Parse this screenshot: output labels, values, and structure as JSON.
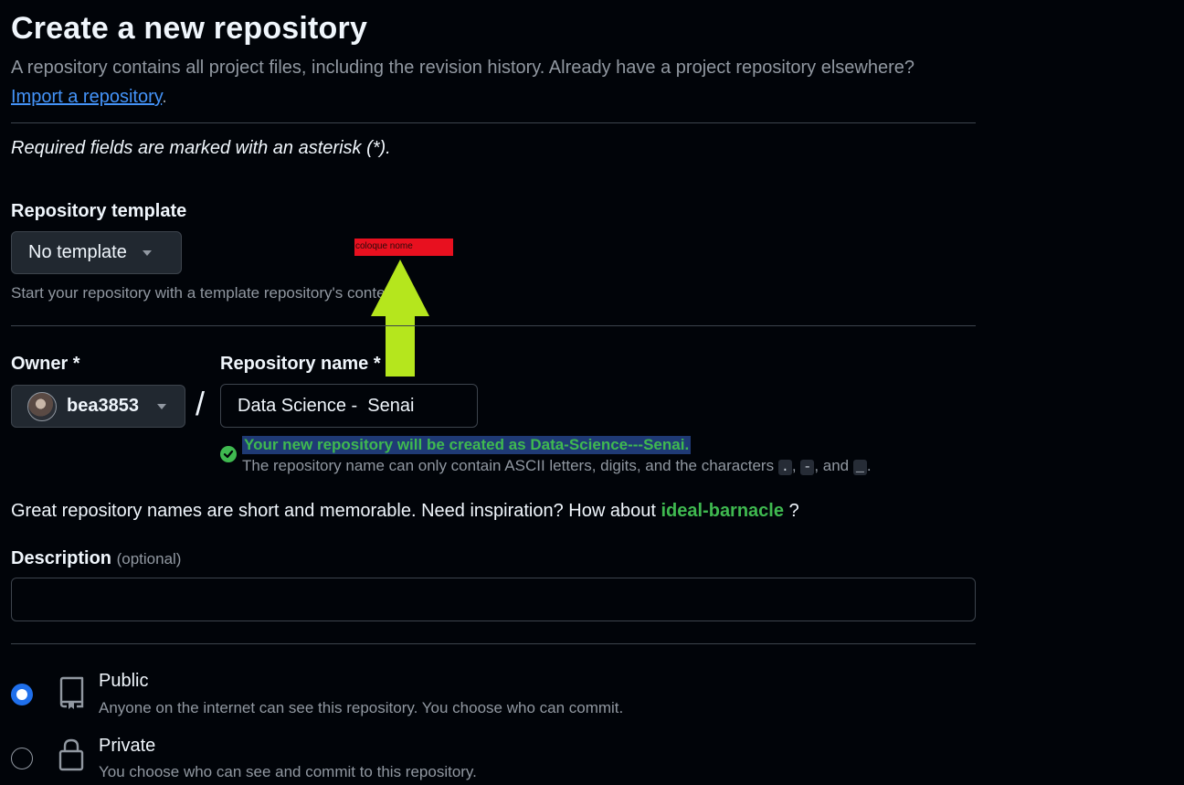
{
  "header": {
    "title": "Create a new repository",
    "subtitle": "A repository contains all project files, including the revision history. Already have a project repository elsewhere?",
    "import_link": "Import a repository",
    "import_suffix": "."
  },
  "required_note": "Required fields are marked with an asterisk (*).",
  "template": {
    "label": "Repository template",
    "selected": "No template",
    "hint": "Start your repository with a template repository's contents."
  },
  "annotation": {
    "note_text": "coloque nome",
    "note_color": "#e8101f",
    "arrow_color": "#b5e61d"
  },
  "owner": {
    "label": "Owner *",
    "selected": "bea3853"
  },
  "separator": "/",
  "repo_name": {
    "label": "Repository name *",
    "value": "Data Science -  Senai",
    "success_message": "Your new repository will be created as Data-Science---Senai.",
    "rules_prefix": "The repository name can only contain ASCII letters, digits, and the characters",
    "rules_char1": ".",
    "rules_sep1": ",",
    "rules_char2": "-",
    "rules_sep2": ", and",
    "rules_char3": "_",
    "rules_end": "."
  },
  "inspiration": {
    "prefix": "Great repository names are short and memorable. Need inspiration? How about",
    "suggestion": "ideal-barnacle",
    "suffix": "?"
  },
  "description": {
    "label": "Description",
    "optional": "(optional)",
    "value": "",
    "placeholder": ""
  },
  "visibility": {
    "options": [
      {
        "title": "Public",
        "description": "Anyone on the internet can see this repository. You choose who can commit.",
        "selected": true,
        "icon": "repo-icon"
      },
      {
        "title": "Private",
        "description": "You choose who can see and commit to this repository.",
        "selected": false,
        "icon": "lock-icon"
      }
    ]
  },
  "colors": {
    "background": "#010409",
    "accent_blue": "#1f6feb",
    "success_green": "#3fb950",
    "link_blue": "#4493f8"
  }
}
